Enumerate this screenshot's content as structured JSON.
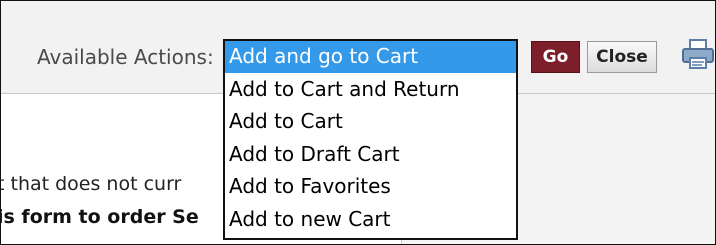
{
  "toolbar": {
    "actions_label": "Available Actions:",
    "selected_action": "Add and go to Cart",
    "go_label": "Go",
    "close_label": "Close",
    "print_icon": "printer-icon"
  },
  "dropdown": {
    "options": [
      "Add and go to Cart",
      "Add to Cart and Return",
      "Add to Cart",
      "Add to Draft Cart",
      "Add to Favorites",
      "Add to new Cart"
    ],
    "selected_index": 0
  },
  "content": {
    "line_1": "t that does not curr",
    "line_2": "is form to order Se"
  },
  "colors": {
    "go_button": "#7c1f2a",
    "selected_option": "#3399e8",
    "toolbar_bg": "#f2f2f2"
  }
}
